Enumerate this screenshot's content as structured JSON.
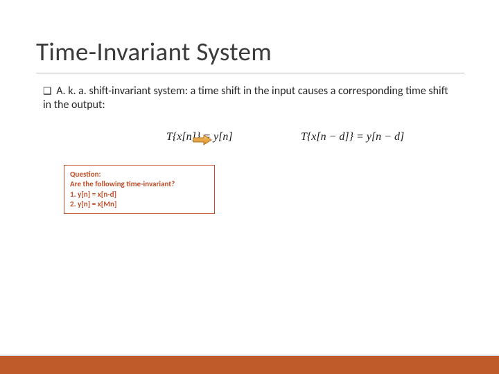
{
  "title": "Time-Invariant System",
  "bullet": {
    "symbol": "❑",
    "text": "A. k. a. shift-invariant system: a time shift in the input causes a corresponding time shift in the output:"
  },
  "equations": {
    "eq1_lhs": "T{x[n]} = y[n]",
    "eq2_lhs": "T{x[n − d]} = y[n − d]"
  },
  "question_box": {
    "line1": "Question:",
    "line2": "Are the following time-invariant?",
    "line3": "1.   y[n] = x[n-d]",
    "line4": "2.   y[n] = x[Mn]"
  },
  "colors": {
    "accent": "#bf4d28",
    "footer": "#bf5a2a"
  }
}
